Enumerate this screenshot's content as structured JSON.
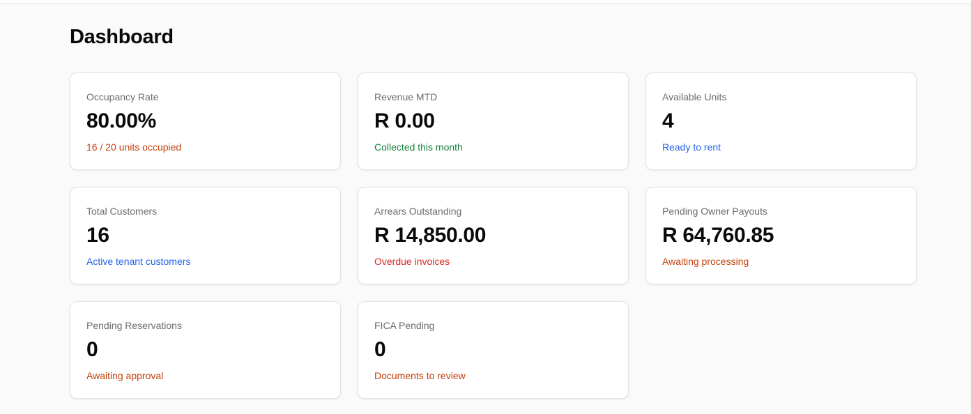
{
  "page": {
    "title": "Dashboard"
  },
  "cards": [
    {
      "label": "Occupancy Rate",
      "value": "80.00%",
      "subtitle": "16 / 20 units occupied",
      "subtitle_color": "#c2410c"
    },
    {
      "label": "Revenue MTD",
      "value": "R 0.00",
      "subtitle": "Collected this month",
      "subtitle_color": "#15803d"
    },
    {
      "label": "Available Units",
      "value": "4",
      "subtitle": "Ready to rent",
      "subtitle_color": "#2563eb"
    },
    {
      "label": "Total Customers",
      "value": "16",
      "subtitle": "Active tenant customers",
      "subtitle_color": "#2563eb"
    },
    {
      "label": "Arrears Outstanding",
      "value": "R 14,850.00",
      "subtitle": "Overdue invoices",
      "subtitle_color": "#dc2626"
    },
    {
      "label": "Pending Owner Payouts",
      "value": "R 64,760.85",
      "subtitle": "Awaiting processing",
      "subtitle_color": "#c2410c"
    },
    {
      "label": "Pending Reservations",
      "value": "0",
      "subtitle": "Awaiting approval",
      "subtitle_color": "#c2410c"
    },
    {
      "label": "FICA Pending",
      "value": "0",
      "subtitle": "Documents to review",
      "subtitle_color": "#c2410c"
    }
  ]
}
